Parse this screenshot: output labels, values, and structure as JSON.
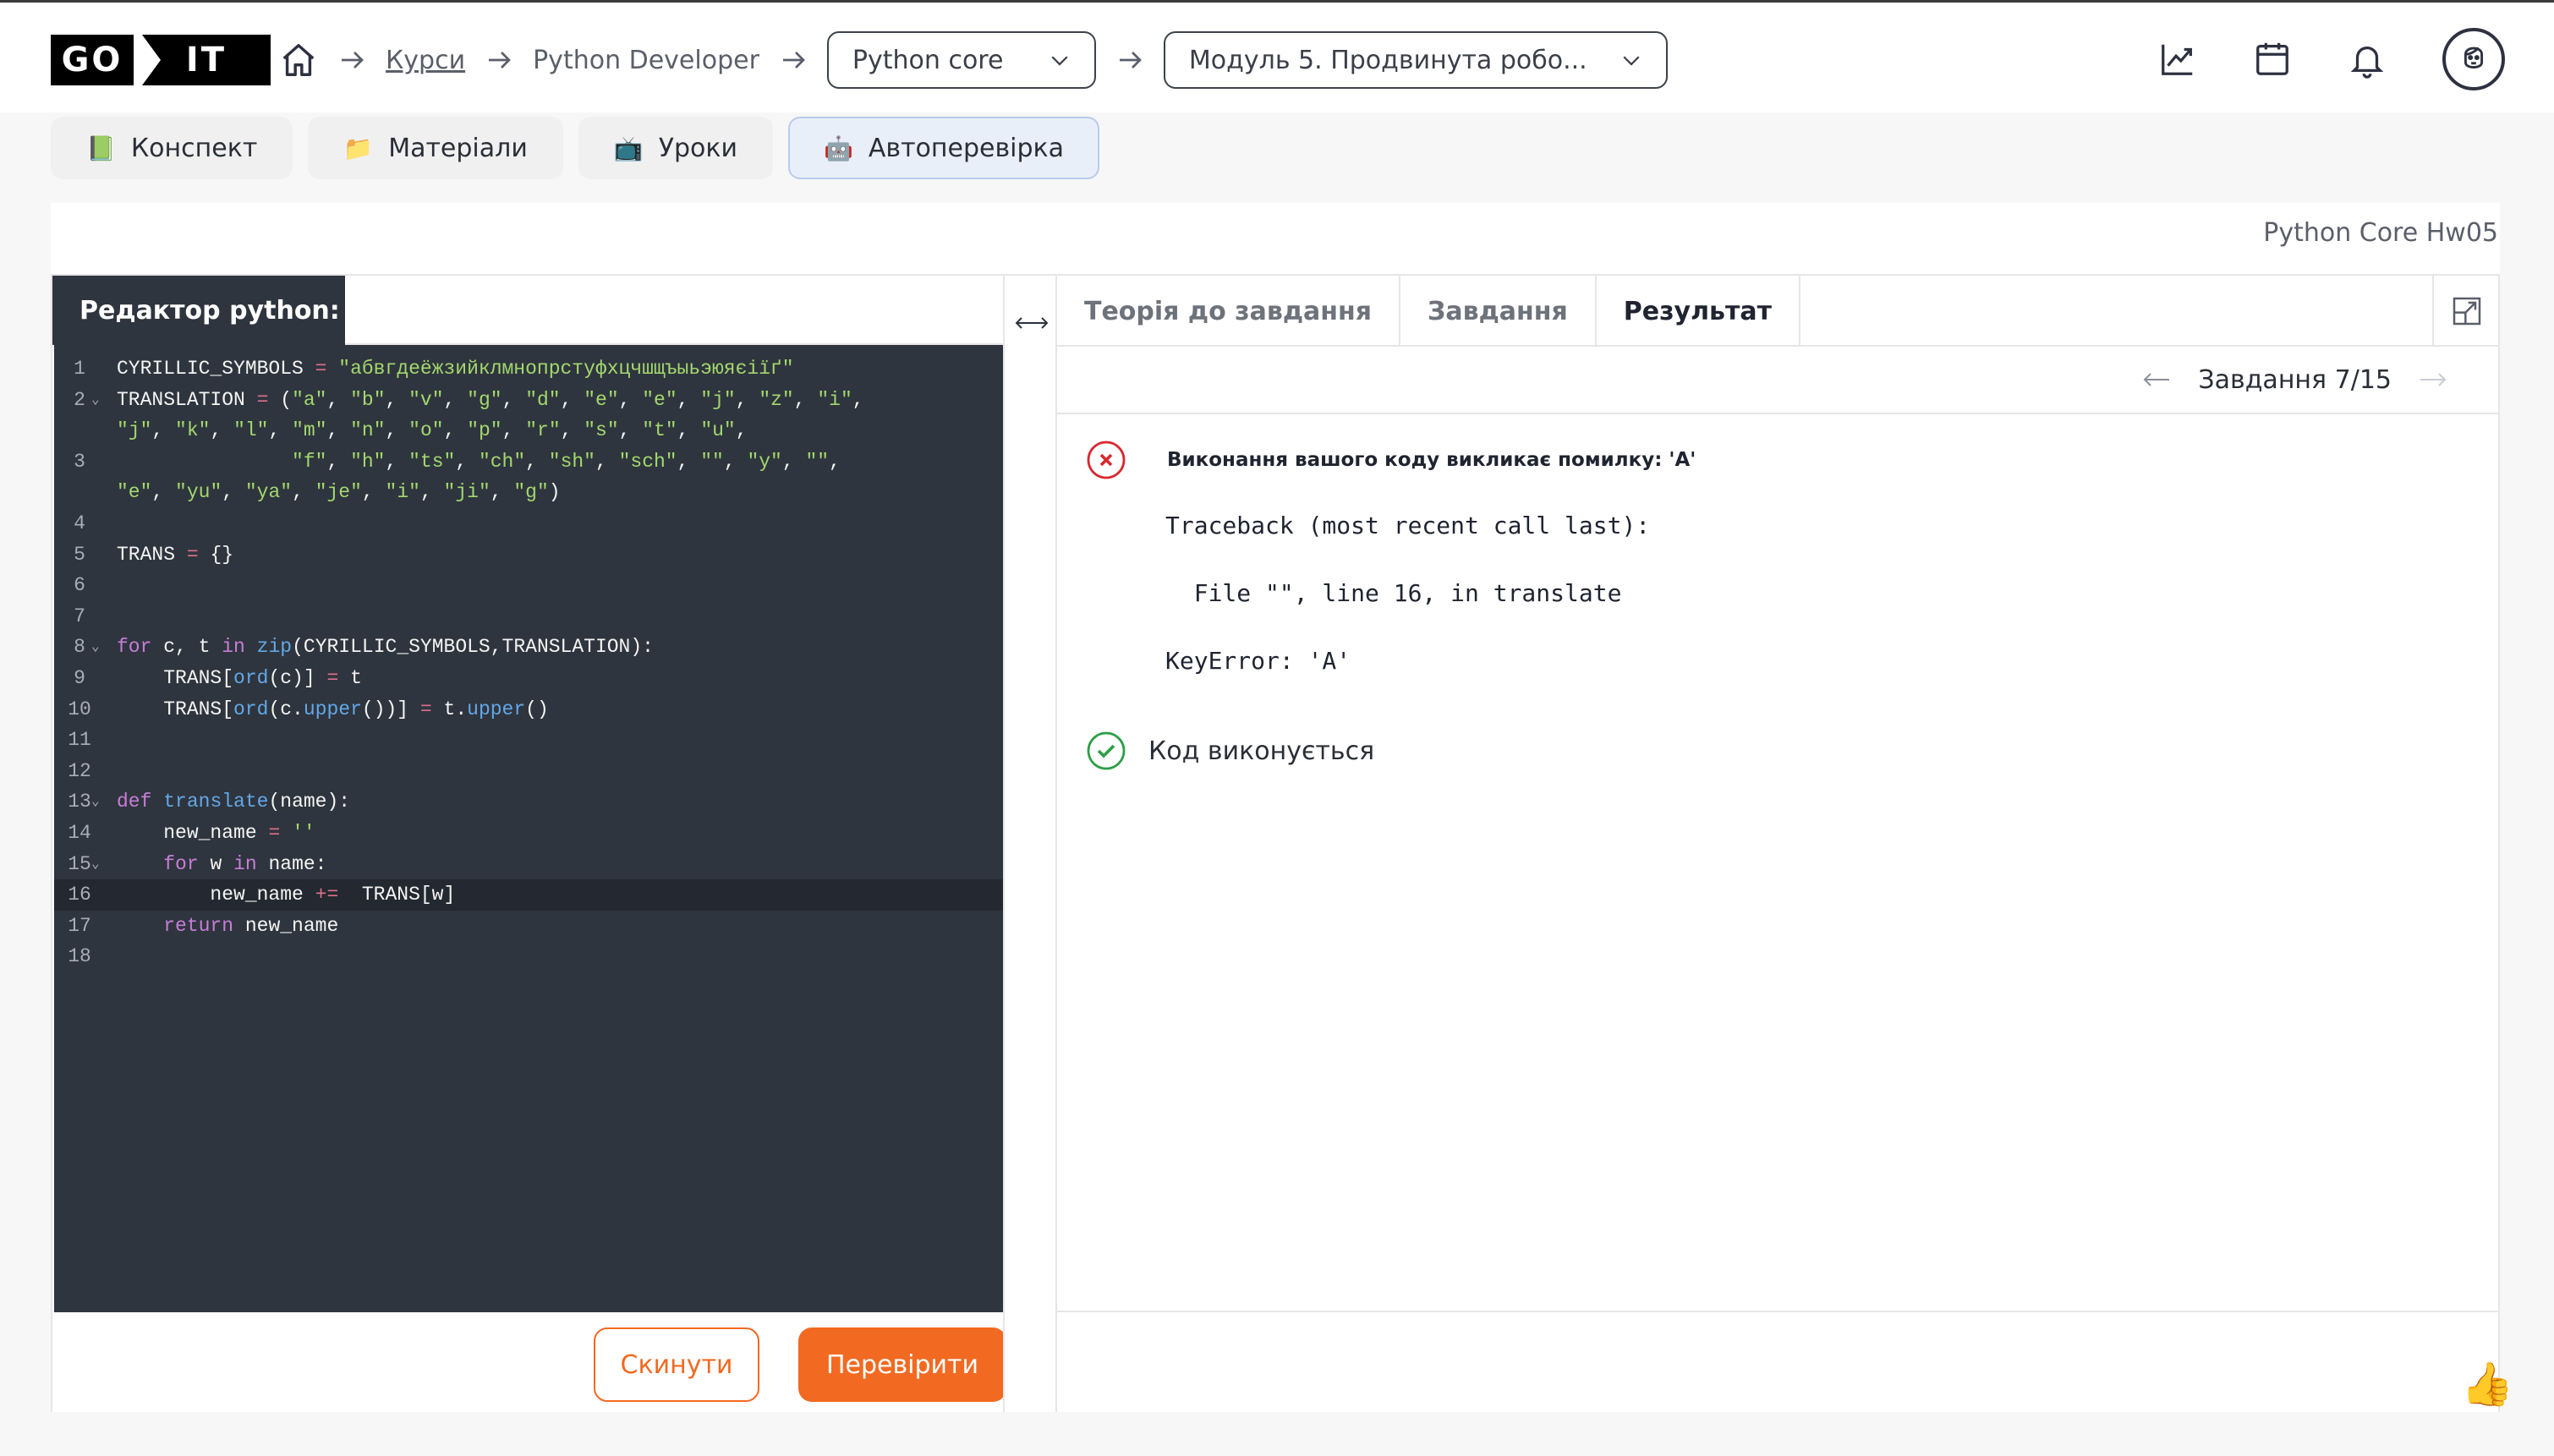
{
  "colors": {
    "accent": "#f26a21",
    "editor_bg": "#2f353e",
    "error": "#d9282f",
    "success": "#2e9e47"
  },
  "header": {
    "logo_left": "GO",
    "logo_right": "IT",
    "breadcrumb": {
      "home_icon": "home-icon",
      "courses": "Курси",
      "program": "Python Developer",
      "course_select": "Python core",
      "module_select": "Модуль 5. Продвинута робо..."
    },
    "icons": [
      "chart-icon",
      "calendar-icon",
      "bell-icon",
      "avatar"
    ]
  },
  "tabs": [
    {
      "emoji": "📗",
      "label": "Конспект"
    },
    {
      "emoji": "📁",
      "label": "Матеріали"
    },
    {
      "emoji": "📺",
      "label": "Уроки"
    },
    {
      "emoji": "🤖",
      "label": "Автоперевірка"
    }
  ],
  "homework_title": "Python Core Hw05",
  "editor": {
    "label": "Редактор python:",
    "reset_label": "Скинути",
    "check_label": "Перевірити"
  },
  "right": {
    "tabs": [
      "Теорія до завдання",
      "Завдання",
      "Результат"
    ],
    "task_counter": "Завдання 7/15",
    "error_title": "Виконання вашого коду викликає помилку: 'A'",
    "traceback": [
      "Traceback (most recent call last):",
      "  File \"\", line 16, in translate",
      "KeyError: 'A'"
    ],
    "ok_text": "Код виконується"
  },
  "code_lines": [
    {
      "n": "1",
      "fold": "",
      "text": "CYRILLIC_SYMBOLS = \"абвгдеёжзийклмнопрстуфхцчшщъыьэюяєіїґ\""
    },
    {
      "n": "2",
      "fold": "⌄",
      "text": "TRANSLATION = (\"a\", \"b\", \"v\", \"g\", \"d\", \"e\", \"e\", \"j\", \"z\", \"i\","
    },
    {
      "n": "",
      "fold": "",
      "text": "\"j\", \"k\", \"l\", \"m\", \"n\", \"o\", \"p\", \"r\", \"s\", \"t\", \"u\","
    },
    {
      "n": "3",
      "fold": "",
      "text": "               \"f\", \"h\", \"ts\", \"ch\", \"sh\", \"sch\", \"\", \"y\", \"\","
    },
    {
      "n": "",
      "fold": "",
      "text": "\"e\", \"yu\", \"ya\", \"je\", \"i\", \"ji\", \"g\")"
    },
    {
      "n": "4",
      "fold": "",
      "text": ""
    },
    {
      "n": "5",
      "fold": "",
      "text": "TRANS = {}"
    },
    {
      "n": "6",
      "fold": "",
      "text": ""
    },
    {
      "n": "7",
      "fold": "",
      "text": ""
    },
    {
      "n": "8",
      "fold": "⌄",
      "text": "for c, t in zip(CYRILLIC_SYMBOLS,TRANSLATION):"
    },
    {
      "n": "9",
      "fold": "",
      "text": "    TRANS[ord(c)] = t"
    },
    {
      "n": "10",
      "fold": "",
      "text": "    TRANS[ord(c.upper())] = t.upper()"
    },
    {
      "n": "11",
      "fold": "",
      "text": ""
    },
    {
      "n": "12",
      "fold": "",
      "text": ""
    },
    {
      "n": "13",
      "fold": "⌄",
      "text": "def translate(name):"
    },
    {
      "n": "14",
      "fold": "",
      "text": "    new_name = ''"
    },
    {
      "n": "15",
      "fold": "⌄",
      "text": "    for w in name:"
    },
    {
      "n": "16",
      "fold": "",
      "text": "        new_name +=  TRANS[w]"
    },
    {
      "n": "17",
      "fold": "",
      "text": "    return new_name"
    },
    {
      "n": "18",
      "fold": "",
      "text": ""
    }
  ],
  "highlighted_line": "16"
}
